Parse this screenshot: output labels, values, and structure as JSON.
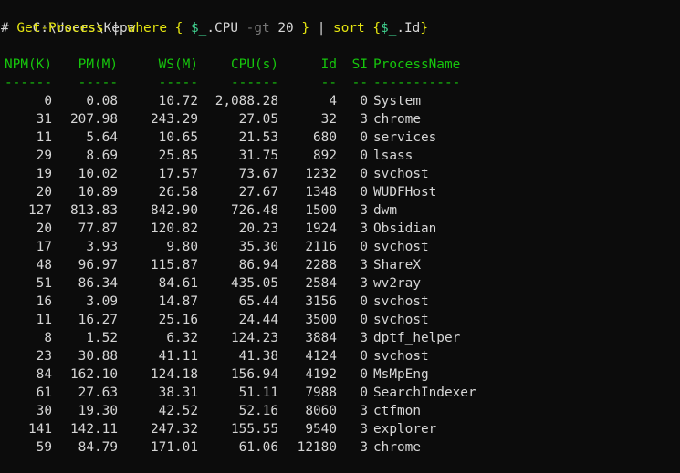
{
  "prompt": {
    "path": "C:\\Users\\Kepa",
    "comment_marker": "#",
    "cmd": "Get-Process",
    "pipe1": "|",
    "where": "where",
    "brace_open": "{",
    "var": "$_",
    "prop": ".CPU",
    "op": "-gt",
    "num": "20",
    "brace_close": "}",
    "pipe2": "|",
    "sort": "sort",
    "sort_brace_open": "{",
    "sort_var": "$_",
    "sort_prop": ".Id",
    "sort_brace_close": "}"
  },
  "table": {
    "headers": [
      "NPM(K)",
      "PM(M)",
      "WS(M)",
      "CPU(s)",
      "Id",
      "SI",
      "ProcessName"
    ],
    "dashes": [
      "------",
      "-----",
      "-----",
      "------",
      "--",
      "--",
      "-----------"
    ],
    "rows": [
      [
        "0",
        "0.08",
        "10.72",
        "2,088.28",
        "4",
        "0",
        "System"
      ],
      [
        "31",
        "207.98",
        "243.29",
        "27.05",
        "32",
        "3",
        "chrome"
      ],
      [
        "11",
        "5.64",
        "10.65",
        "21.53",
        "680",
        "0",
        "services"
      ],
      [
        "29",
        "8.69",
        "25.85",
        "31.75",
        "892",
        "0",
        "lsass"
      ],
      [
        "19",
        "10.02",
        "17.57",
        "73.67",
        "1232",
        "0",
        "svchost"
      ],
      [
        "20",
        "10.89",
        "26.58",
        "27.67",
        "1348",
        "0",
        "WUDFHost"
      ],
      [
        "127",
        "813.83",
        "842.90",
        "726.48",
        "1500",
        "3",
        "dwm"
      ],
      [
        "20",
        "77.87",
        "120.82",
        "20.23",
        "1924",
        "3",
        "Obsidian"
      ],
      [
        "17",
        "3.93",
        "9.80",
        "35.30",
        "2116",
        "0",
        "svchost"
      ],
      [
        "48",
        "96.97",
        "115.87",
        "86.94",
        "2288",
        "3",
        "ShareX"
      ],
      [
        "51",
        "86.34",
        "84.61",
        "435.05",
        "2584",
        "3",
        "wv2ray"
      ],
      [
        "16",
        "3.09",
        "14.87",
        "65.44",
        "3156",
        "0",
        "svchost"
      ],
      [
        "11",
        "16.27",
        "25.16",
        "24.44",
        "3500",
        "0",
        "svchost"
      ],
      [
        "8",
        "1.52",
        "6.32",
        "124.23",
        "3884",
        "3",
        "dptf_helper"
      ],
      [
        "23",
        "30.88",
        "41.11",
        "41.38",
        "4124",
        "0",
        "svchost"
      ],
      [
        "84",
        "162.10",
        "124.18",
        "156.94",
        "4192",
        "0",
        "MsMpEng"
      ],
      [
        "61",
        "27.63",
        "38.31",
        "51.11",
        "7988",
        "0",
        "SearchIndexer"
      ],
      [
        "30",
        "19.30",
        "42.52",
        "52.16",
        "8060",
        "3",
        "ctfmon"
      ],
      [
        "141",
        "142.11",
        "247.32",
        "155.55",
        "9540",
        "3",
        "explorer"
      ],
      [
        "59",
        "84.79",
        "171.01",
        "61.06",
        "12180",
        "3",
        "chrome"
      ]
    ]
  },
  "colors": {
    "background": "#0c0c0c",
    "text": "#d6d6d6",
    "header_green": "#16c60c",
    "keyword_yellow": "#e5e510",
    "variable_green": "#3fcf8e",
    "operator_gray": "#767676"
  }
}
